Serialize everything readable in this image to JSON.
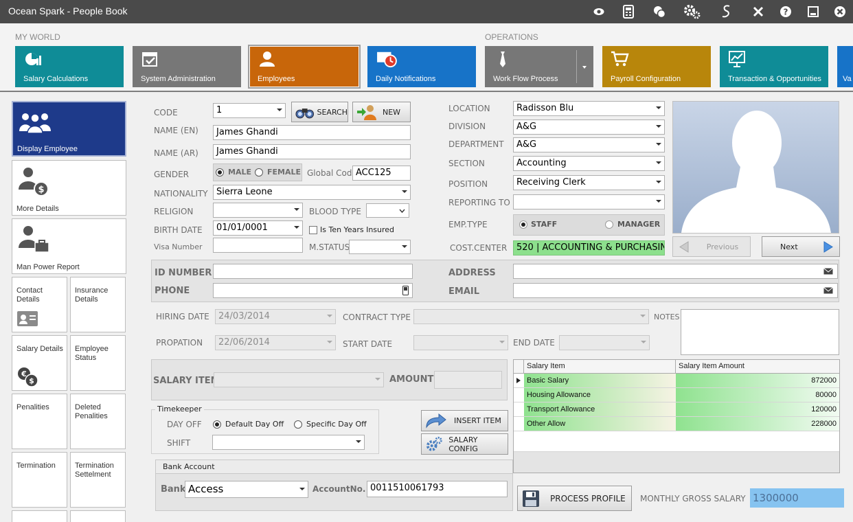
{
  "app": {
    "title": "Ocean Spark - People Book"
  },
  "titlebar_icons": [
    "eye-icon",
    "calculator-icon",
    "coins-icon",
    "gears-icon",
    "signature-icon",
    "tools-icon",
    "help-icon",
    "minimize-icon",
    "close-icon"
  ],
  "ribbon": {
    "groups": {
      "my_world": "MY WORLD",
      "operations": "OPERATIONS"
    },
    "tiles": [
      {
        "label": "Salary Calculations",
        "color": "#0f8c97"
      },
      {
        "label": "System Administration",
        "color": "#777777"
      },
      {
        "label": "Employees",
        "color": "#c8660a"
      },
      {
        "label": "Daily Notifications",
        "color": "#1773c8"
      },
      {
        "label": "Work Flow Process",
        "color": "#777777"
      },
      {
        "label": "Payroll Configuration",
        "color": "#b8860b"
      },
      {
        "label": "Transaction & Opportunities",
        "color": "#0f8c97"
      },
      {
        "label": "Va",
        "color": "#1773c8"
      }
    ]
  },
  "sidebar": {
    "display_employee": "Display Employee",
    "more_details": "More Details",
    "man_power_report": "Man Power Report",
    "contact_details": "Contact Details",
    "insurance_details": "Insurance Details",
    "salary_details": "Salary Details",
    "employee_status": "Employee Status",
    "penalities": "Penalities",
    "deleted_penalities": "Deleted Penalities",
    "termination": "Termination",
    "termination_settlement": "Termination Settelment"
  },
  "form": {
    "code_label": "CODE",
    "code_value": "1",
    "search_label": "SEARCH",
    "new_label": "NEW",
    "name_en_label": "NAME (EN)",
    "name_en_value": "James Ghandi",
    "name_ar_label": "NAME (AR)",
    "name_ar_value": "James Ghandi",
    "gender_label": "GENDER",
    "male_label": "MALE",
    "female_label": "FEMALE",
    "gender_value": "MALE",
    "global_code_label": "Global Code",
    "global_code_value": "ACC125",
    "nationality_label": "NATIONALITY",
    "nationality_value": "Sierra Leone",
    "religion_label": "RELIGION",
    "religion_value": "",
    "blood_type_label": "BLOOD TYPE",
    "blood_type_value": "",
    "birth_date_label": "BIRTH DATE",
    "birth_date_value": "01/01/0001",
    "ten_years_label": "Is Ten Years Insured",
    "ten_years_checked": false,
    "visa_label": "Visa Number",
    "visa_value": "",
    "mstatus_label": "M.STATUS",
    "mstatus_value": "",
    "location_label": "LOCATION",
    "location_value": "Radisson Blu",
    "division_label": "DIVISION",
    "division_value": "A&G",
    "department_label": "DEPARTMENT",
    "department_value": "A&G",
    "section_label": "SECTION",
    "section_value": "Accounting",
    "position_label": "POSITION",
    "position_value": "Receiving Clerk",
    "reporting_label": "REPORTING TO",
    "reporting_value": "",
    "emp_type_label": "EMP.TYPE",
    "staff_label": "STAFF",
    "manager_label": "MANAGER",
    "emp_type_value": "STAFF",
    "cost_center_label": "COST.CENTER",
    "cost_center_value": "520 |  ACCOUNTING & PURCHASIN"
  },
  "photo": {
    "previous_label": "Previous",
    "next_label": "Next"
  },
  "contact": {
    "id_label": "ID NUMBER",
    "id_value": "",
    "phone_label": "PHONE",
    "phone_value": "",
    "address_label": "ADDRESS",
    "address_value": "",
    "email_label": "EMAIL",
    "email_value": ""
  },
  "dates": {
    "hiring_label": "HIRING DATE",
    "hiring_value": "24/03/2014",
    "contract_label": "CONTRACT TYPE",
    "contract_value": "",
    "notes_label": "NOTES",
    "notes_value": "",
    "propation_label": "PROPATION",
    "propation_value": "22/06/2014",
    "start_label": "START DATE",
    "start_value": "",
    "end_label": "END DATE",
    "end_value": ""
  },
  "salary": {
    "item_label": "SALARY ITEM",
    "item_value": "",
    "amount_label": "AMOUNT",
    "amount_value": "",
    "insert_label": "INSERT ITEM",
    "config_label": "SALARY CONFIG"
  },
  "timekeeper": {
    "title": "Timekeeper",
    "day_off_label": "DAY OFF",
    "default_label": "Default Day Off",
    "specific_label": "Specific Day Off",
    "day_off_value": "Default Day Off",
    "shift_label": "SHIFT",
    "shift_value": ""
  },
  "bank": {
    "title": "Bank Account",
    "bank_label": "Bank",
    "bank_value": "Access",
    "account_label": "AccountNo.",
    "account_value": "0011510061793"
  },
  "grid": {
    "columns": [
      "Salary Item",
      "Salary Item Amount"
    ],
    "rows": [
      {
        "item": "Basic Salary",
        "amount": "872000"
      },
      {
        "item": "Housing Allowance",
        "amount": "80000"
      },
      {
        "item": "Transport Allowance",
        "amount": "120000"
      },
      {
        "item": "Other Allow",
        "amount": "228000"
      }
    ]
  },
  "footer": {
    "process_label": "PROCESS PROFILE",
    "gross_label": "MONTHLY GROSS SALARY",
    "gross_value": "1300000"
  }
}
